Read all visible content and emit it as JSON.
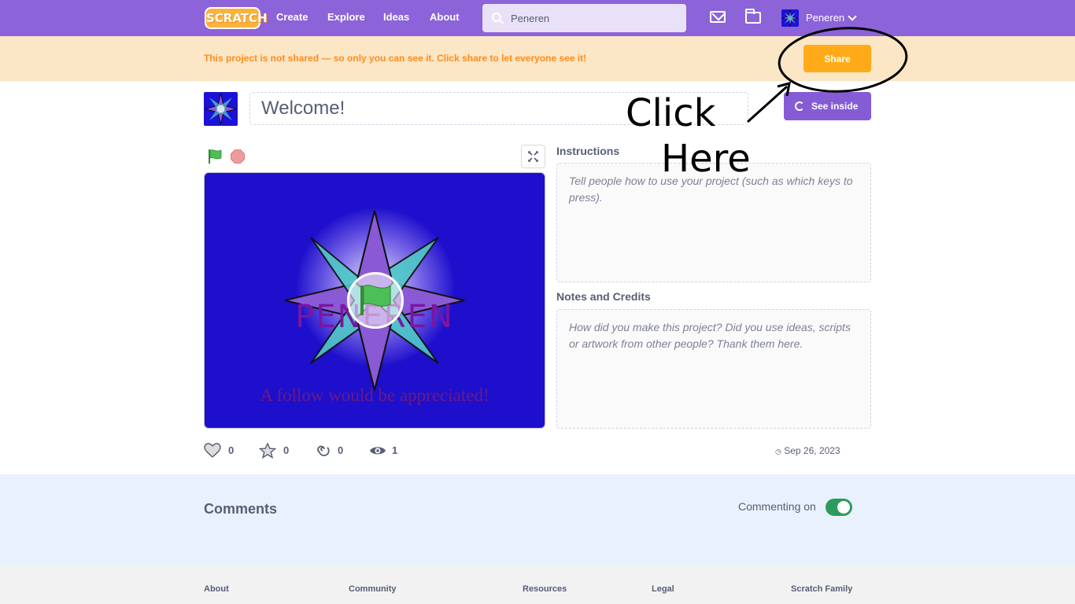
{
  "nav": {
    "logo": "SCRATCH",
    "links": [
      "Create",
      "Explore",
      "Ideas",
      "About"
    ],
    "search_value": "Peneren",
    "username": "Peneren"
  },
  "banner": {
    "message": "This project is not shared — so only you can see it. Click share to let everyone see it!",
    "share_label": "Share"
  },
  "project": {
    "title": "Welcome!",
    "see_inside_label": "See inside",
    "stage_title": "PENEREN",
    "stage_caption": "A follow would be appreciated!"
  },
  "instructions": {
    "label": "Instructions",
    "placeholder": "Tell people how to use your project (such as which keys to press)."
  },
  "notes": {
    "label": "Notes and Credits",
    "placeholder": "How did you make this project? Did you use ideas, scripts or artwork from other people? Thank them here."
  },
  "stats": {
    "loves": "0",
    "favorites": "0",
    "remixes": "0",
    "views": "1",
    "date": "Sep 26, 2023"
  },
  "comments": {
    "title": "Comments",
    "commenting_label": "Commenting on",
    "commenting_on": true
  },
  "footer": {
    "columns": [
      "About",
      "Community",
      "Resources",
      "Legal",
      "Scratch Family"
    ]
  },
  "annotation": {
    "line1": "Click",
    "line2": "Here"
  },
  "colors": {
    "nav": "#8c63d9",
    "banner": "#fbe6c6",
    "share": "#ffab19",
    "see_inside": "#855cd6",
    "stage": "#1e0fcc"
  }
}
